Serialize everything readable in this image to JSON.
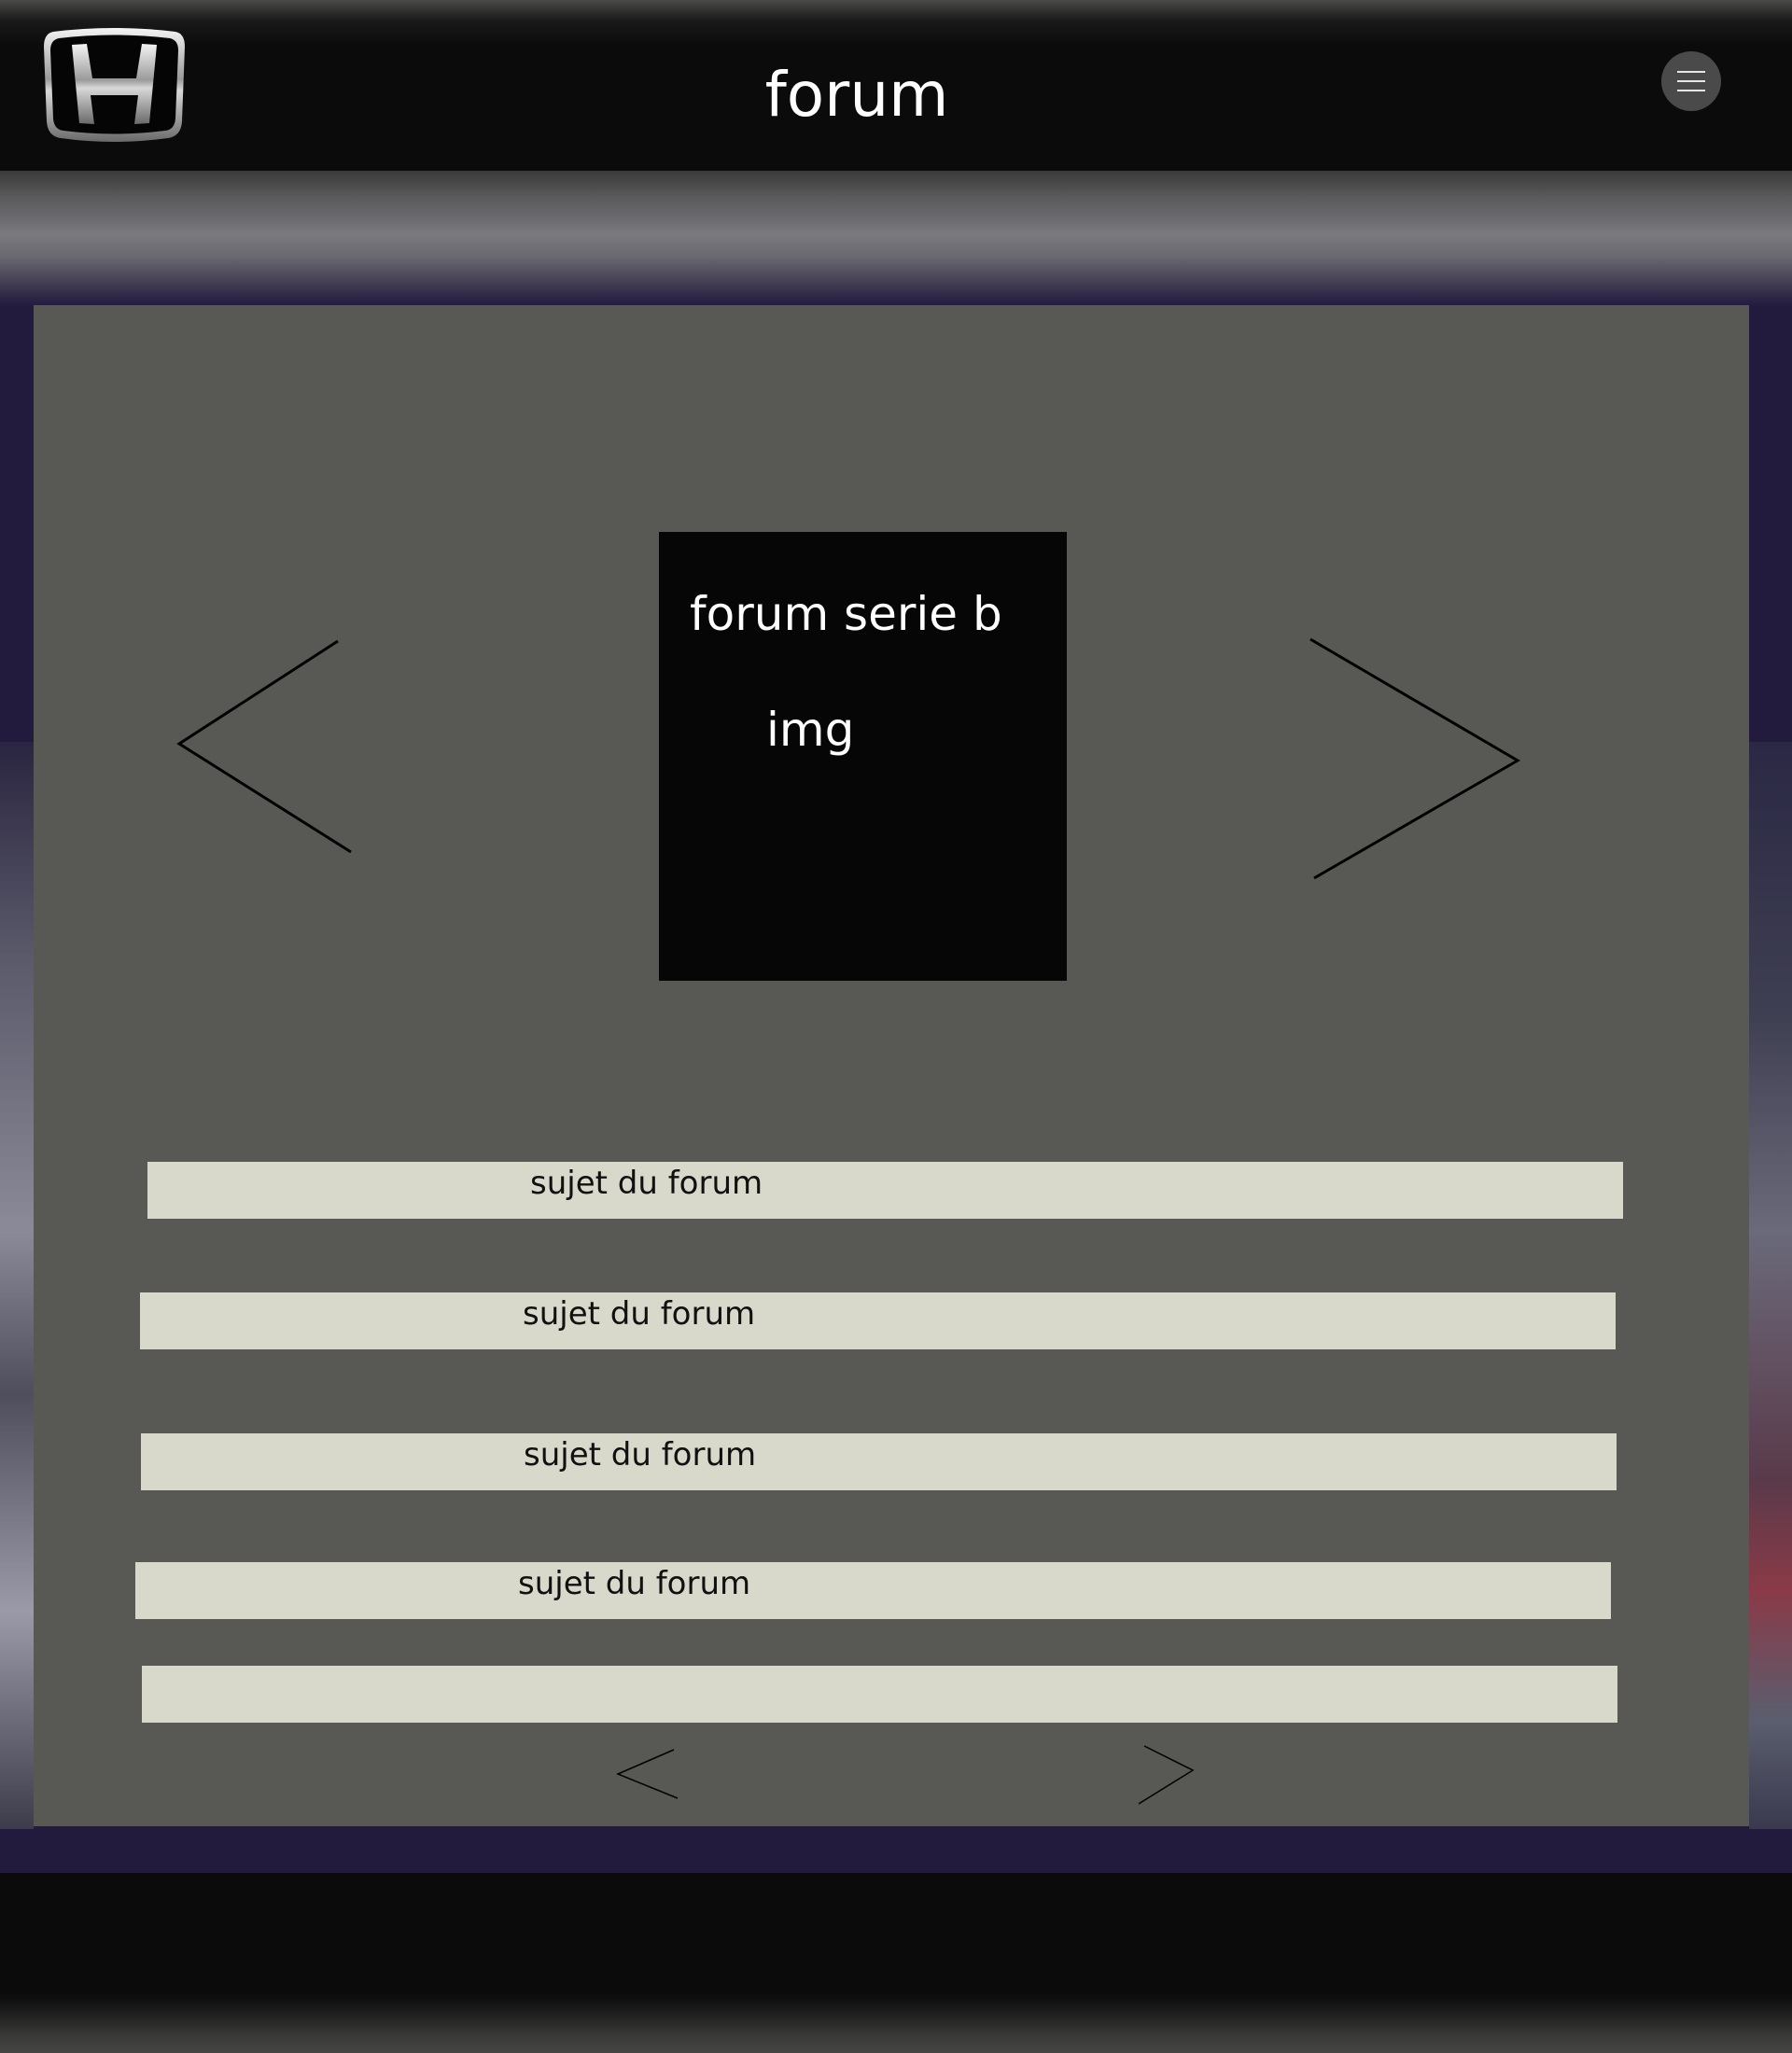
{
  "header": {
    "title": "forum"
  },
  "featured": {
    "title": "forum serie b",
    "image_placeholder": "img"
  },
  "topics": [
    {
      "label": "sujet du forum"
    },
    {
      "label": "sujet du forum"
    },
    {
      "label": "sujet du forum"
    },
    {
      "label": "sujet du forum"
    },
    {
      "label": ""
    }
  ],
  "icons": {
    "logo": "honda-logo",
    "menu": "hamburger-menu-icon",
    "carousel_prev": "chevron-left-icon",
    "carousel_next": "chevron-right-icon",
    "page_prev": "chevron-left-icon",
    "page_next": "chevron-right-icon"
  },
  "colors": {
    "header_bg": "#0b0b0b",
    "panel_bg": "#585954",
    "topic_bg": "#d8d8cb",
    "featured_bg": "#060606",
    "page_bg": "#231b3d"
  }
}
